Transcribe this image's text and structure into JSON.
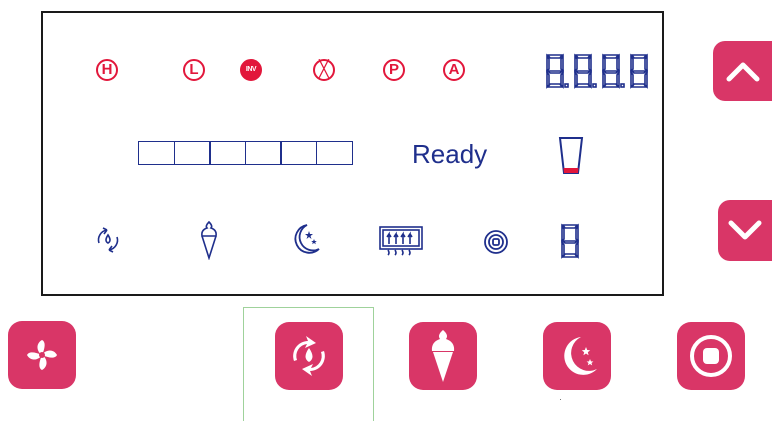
{
  "display": {
    "indicators": [
      {
        "name": "heat-indicator",
        "label": "H"
      },
      {
        "name": "low-indicator",
        "label": "L"
      },
      {
        "name": "inverter-indicator",
        "label": "INV"
      },
      {
        "name": "error-indicator",
        "label": "X"
      },
      {
        "name": "power-indicator",
        "label": "P"
      },
      {
        "name": "auto-indicator",
        "label": "A"
      }
    ],
    "digits": "8.8.8.8",
    "status": "Ready",
    "level_segments": 6,
    "cup_icon": "cup-icon",
    "mode_icons": [
      "defrost-cycle-icon",
      "ice-cream-icon",
      "night-mode-icon",
      "heater-icon",
      "stop-icon",
      "single-digit-icon"
    ]
  },
  "controls": {
    "up": "chevron-up-icon",
    "down": "chevron-down-icon",
    "fan": "fan-icon",
    "defrost": "defrost-cycle-icon",
    "ice_cream": "ice-cream-icon",
    "night": "night-mode-icon",
    "stop": "stop-icon"
  },
  "colors": {
    "indicator_red": "#e2173b",
    "lcd_blue": "#1f2f8c",
    "button_pink": "#d93667"
  }
}
